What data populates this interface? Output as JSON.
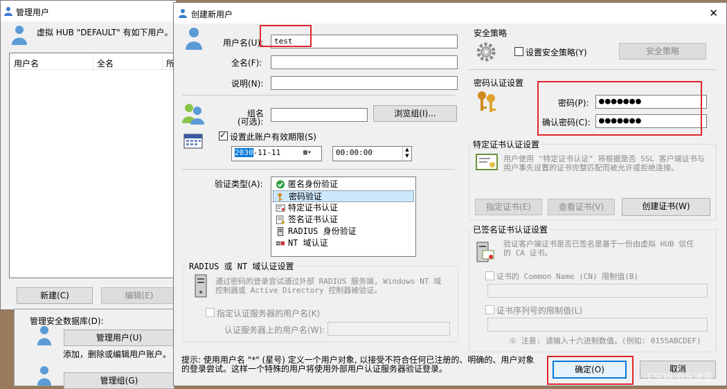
{
  "top_right_text": "",
  "bg_window": {
    "title": "管理用户",
    "desc": "虚拟 HUB \"DEFAULT\" 有如下用户。",
    "columns": [
      "用户名",
      "全名",
      "所"
    ],
    "new_button": "新建(C)",
    "edit_button": "编辑(E)"
  },
  "bg_panel": {
    "group_title": "管理安全数据库(D):",
    "manage_users_button": "管理用户(U)",
    "manage_users_desc": "添加，删除或编辑用户账户。",
    "manage_groups_button": "管理组(G)"
  },
  "dialog": {
    "title": "创建新用户",
    "close_glyph": "✕",
    "username_label": "用户名(U):",
    "username_value": "test",
    "fullname_label": "全名(F):",
    "note_label": "说明(N):",
    "group_label_1": "组名",
    "group_label_2": "(可选):",
    "browse_group_button": "浏览组(I)...",
    "expire_label": "设置此账户有效期限(S)",
    "expire_checked": true,
    "date_year": "2030",
    "date_rest": "-11-11",
    "time_value": "00:00:00",
    "auth_type_label": "验证类型(A):",
    "auth_types": [
      {
        "label": "匿名身份验证",
        "icon": "check-circle-icon",
        "selected": false
      },
      {
        "label": "密码验证",
        "icon": "key-icon",
        "selected": true
      },
      {
        "label": "特定证书认证",
        "icon": "certificate-icon",
        "selected": false
      },
      {
        "label": "签名证书认证",
        "icon": "signed-certificate-icon",
        "selected": false
      },
      {
        "label": "RADIUS 身份验证",
        "icon": "server-icon",
        "selected": false
      },
      {
        "label": "NT 域认证",
        "icon": "domain-icon",
        "selected": false
      }
    ],
    "radius_group": {
      "title": "RADIUS 或 NT 域认证设置",
      "desc_1": "通过密码的登录尝试通过外部 RADIUS 服务端, Windows NT 域",
      "desc_2": "控制器或 Active Directory 控制器被验证。",
      "specify_label": "指定认证服务器的用户名(K)",
      "server_user_label": "认证服务器上的用户名(W):"
    },
    "security_policy": {
      "title": "安全策略",
      "checkbox_label": "设置安全策略(Y)",
      "button": "安全策略"
    },
    "password": {
      "title": "密码认证设置",
      "password_label": "密码(P):",
      "confirm_label": "确认密码(C):",
      "password_mask": "●●●●●●●",
      "confirm_mask": "●●●●●●●"
    },
    "cert": {
      "title": "特定证书认证设置",
      "desc_1": "用户使用 \"特定证书认证\" 将根据是否 SSL 客户端证书与",
      "desc_2": "用户事先设置的证书完整匹配而被允许或拒绝连接。",
      "specify_button": "指定证书(E)",
      "view_button": "查看证书(V)",
      "create_button": "创建证书(W)"
    },
    "signed": {
      "title": "已签名证书认证设置",
      "desc_1": "验证客户端证书是否已签名是基于一份由虚拟 HUB 信任",
      "desc_2": "的 CA 证书。",
      "cn_label": "证书的 Common Name (CN) 限制值(B)",
      "serial_label": "证书序列号的限制值(L)",
      "note": "※ 注意: 请输入十六进制数值。(例如: 0155ABCDEF)"
    },
    "hint_1": "提示: 使用用户名 \"*\" (星号) 定义一个用户对象, 以接受不符合任何已注册的、明确的、用户对象",
    "hint_2": "的登录尝试。这样一个特殊的用户将使用外部用户认证服务器验证登录。",
    "ok_button": "确定(O)",
    "cancel_button": "取消"
  },
  "watermark": "CSDN @东清语",
  "colors": {
    "highlight": "#e0242a",
    "selection": "#cce8ff",
    "date_select": "#0078d7"
  }
}
